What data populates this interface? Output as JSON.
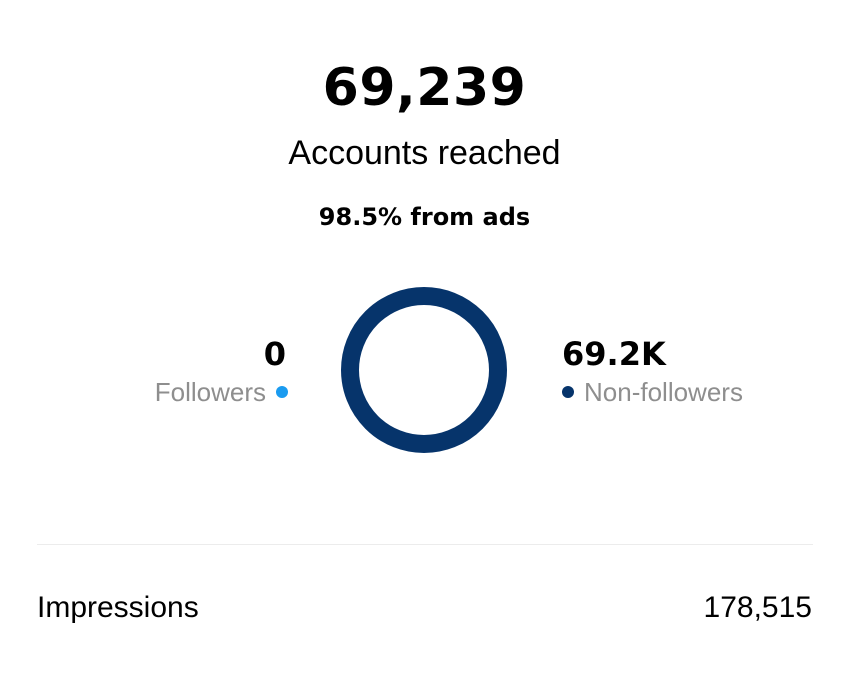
{
  "reach": {
    "total": "69,239",
    "label": "Accounts reached",
    "ads_share": "98.5% from ads"
  },
  "breakdown": {
    "followers": {
      "value": "0",
      "label": "Followers",
      "color": "#1a9bf0"
    },
    "non_followers": {
      "value": "69.2K",
      "label": "Non-followers",
      "color": "#06346b"
    }
  },
  "chart_data": {
    "type": "pie",
    "categories": [
      "Followers",
      "Non-followers"
    ],
    "values": [
      0,
      69239
    ],
    "colors": [
      "#1a9bf0",
      "#06346b"
    ],
    "style": "donut"
  },
  "metrics": [
    {
      "label": "Impressions",
      "value": "178,515"
    }
  ]
}
